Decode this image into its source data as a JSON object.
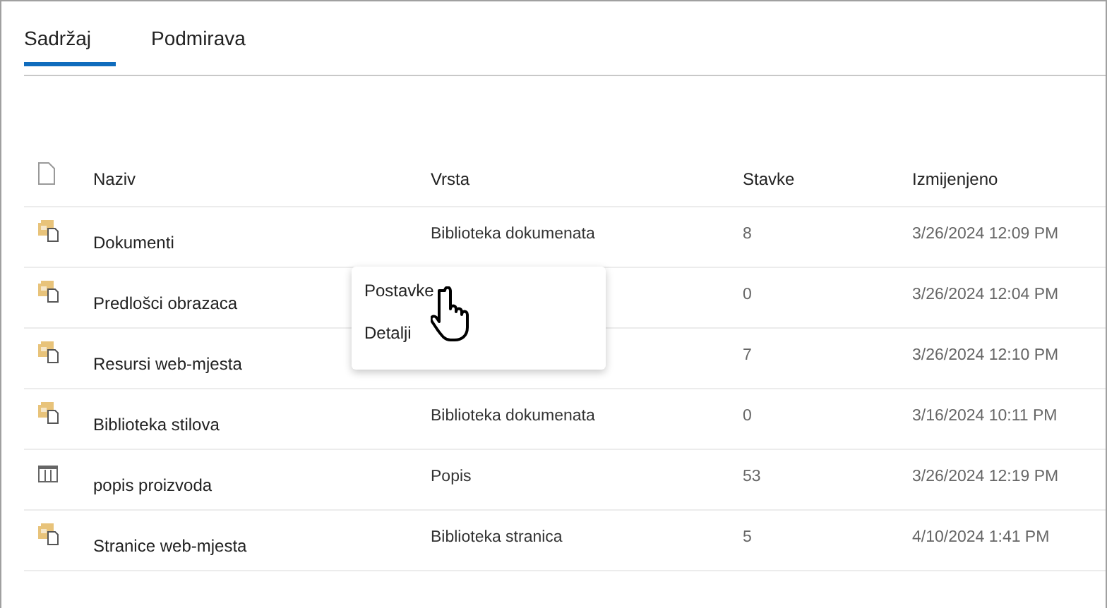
{
  "tabs": [
    {
      "label": "Sadržaj",
      "selected": true
    },
    {
      "label": "Podmirava",
      "selected": false
    }
  ],
  "table": {
    "columns": [
      "Naziv",
      "Vrsta",
      "Stavke",
      "Izmijenjeno"
    ],
    "rows": [
      {
        "kind": "library",
        "name": "Dokumenti",
        "type": "Biblioteka dokumenata",
        "items": "8",
        "modified": "3/26/2024 12:09 PM"
      },
      {
        "kind": "library",
        "name": "Predlošci obrazaca",
        "items": "0",
        "modified": "3/26/2024 12:04 PM"
      },
      {
        "kind": "library",
        "name": "Resursi web-mjesta",
        "items": "7",
        "modified": "3/26/2024 12:10 PM"
      },
      {
        "kind": "library",
        "name": "Biblioteka stilova",
        "type": "Biblioteka dokumenata",
        "items": "0",
        "modified": "3/16/2024 10:11 PM"
      },
      {
        "kind": "list",
        "name": "popis proizvoda",
        "type": "Popis",
        "items": "53",
        "modified": "3/26/2024 12:19 PM"
      },
      {
        "kind": "library",
        "name": "Stranice web-mjesta",
        "type": "Biblioteka stranica",
        "items": "5",
        "modified": "4/10/2024 1:41 PM"
      }
    ]
  },
  "context_menu": {
    "items": [
      "Postavke",
      "Detalji"
    ]
  }
}
